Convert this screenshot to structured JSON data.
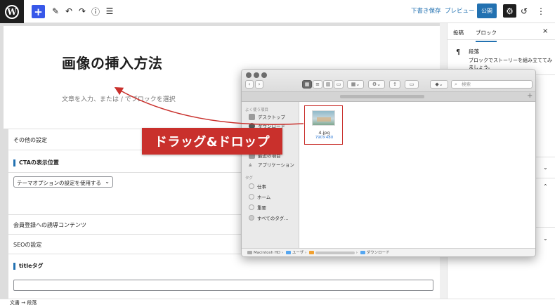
{
  "toolbar": {
    "add_icon": "+",
    "pen_icon": "✎",
    "undo_icon": "↶",
    "redo_icon": "↷",
    "info_icon": "ⓘ",
    "list_icon": "☰",
    "save_draft": "下書き保存",
    "preview": "プレビュー",
    "publish": "公開",
    "settings_icon": "⚙",
    "history_icon": "↺",
    "more_icon": "⋮"
  },
  "editor": {
    "title": "画像の挿入方法",
    "placeholder": "文章を入力、または / でブロックを選択"
  },
  "meta": {
    "other_settings": "その他の設定",
    "cta_title": "CTAの表示位置",
    "cta_select": "テーマオプションの設定を使用する",
    "member_content": "会員登録への誘導コンテンツ",
    "seo_settings": "SEOの設定",
    "title_tag": "titleタグ"
  },
  "sidebar": {
    "tab_post": "投稿",
    "tab_block": "ブロック",
    "close_icon": "×",
    "block_icon": "¶",
    "block_name": "段落",
    "block_desc": "ブロックでストーリーを組み立ててみましょう。"
  },
  "footer": {
    "crumb_doc": "文書",
    "sep": "→",
    "crumb_block": "段落"
  },
  "overlay": {
    "drag_drop_label": "ドラッグ&ドロップ"
  },
  "finder": {
    "search_placeholder": "検索",
    "favorites_head": "よく使う項目",
    "fav_desktop": "デスクトップ",
    "fav_downloads": "ダウンロード",
    "fav_recent": "最近の項目",
    "fav_applications": "アプリケーション",
    "tags_head": "タグ",
    "tag_work": "仕事",
    "tag_home": "ホーム",
    "tag_important": "重要",
    "tag_all": "すべてのタグ...",
    "file_name": "4.jpg",
    "file_dims": "790×480",
    "status_disk": "Macintosh HD",
    "status_users": "ユーザ",
    "status_downloads": "ダウンロード"
  }
}
